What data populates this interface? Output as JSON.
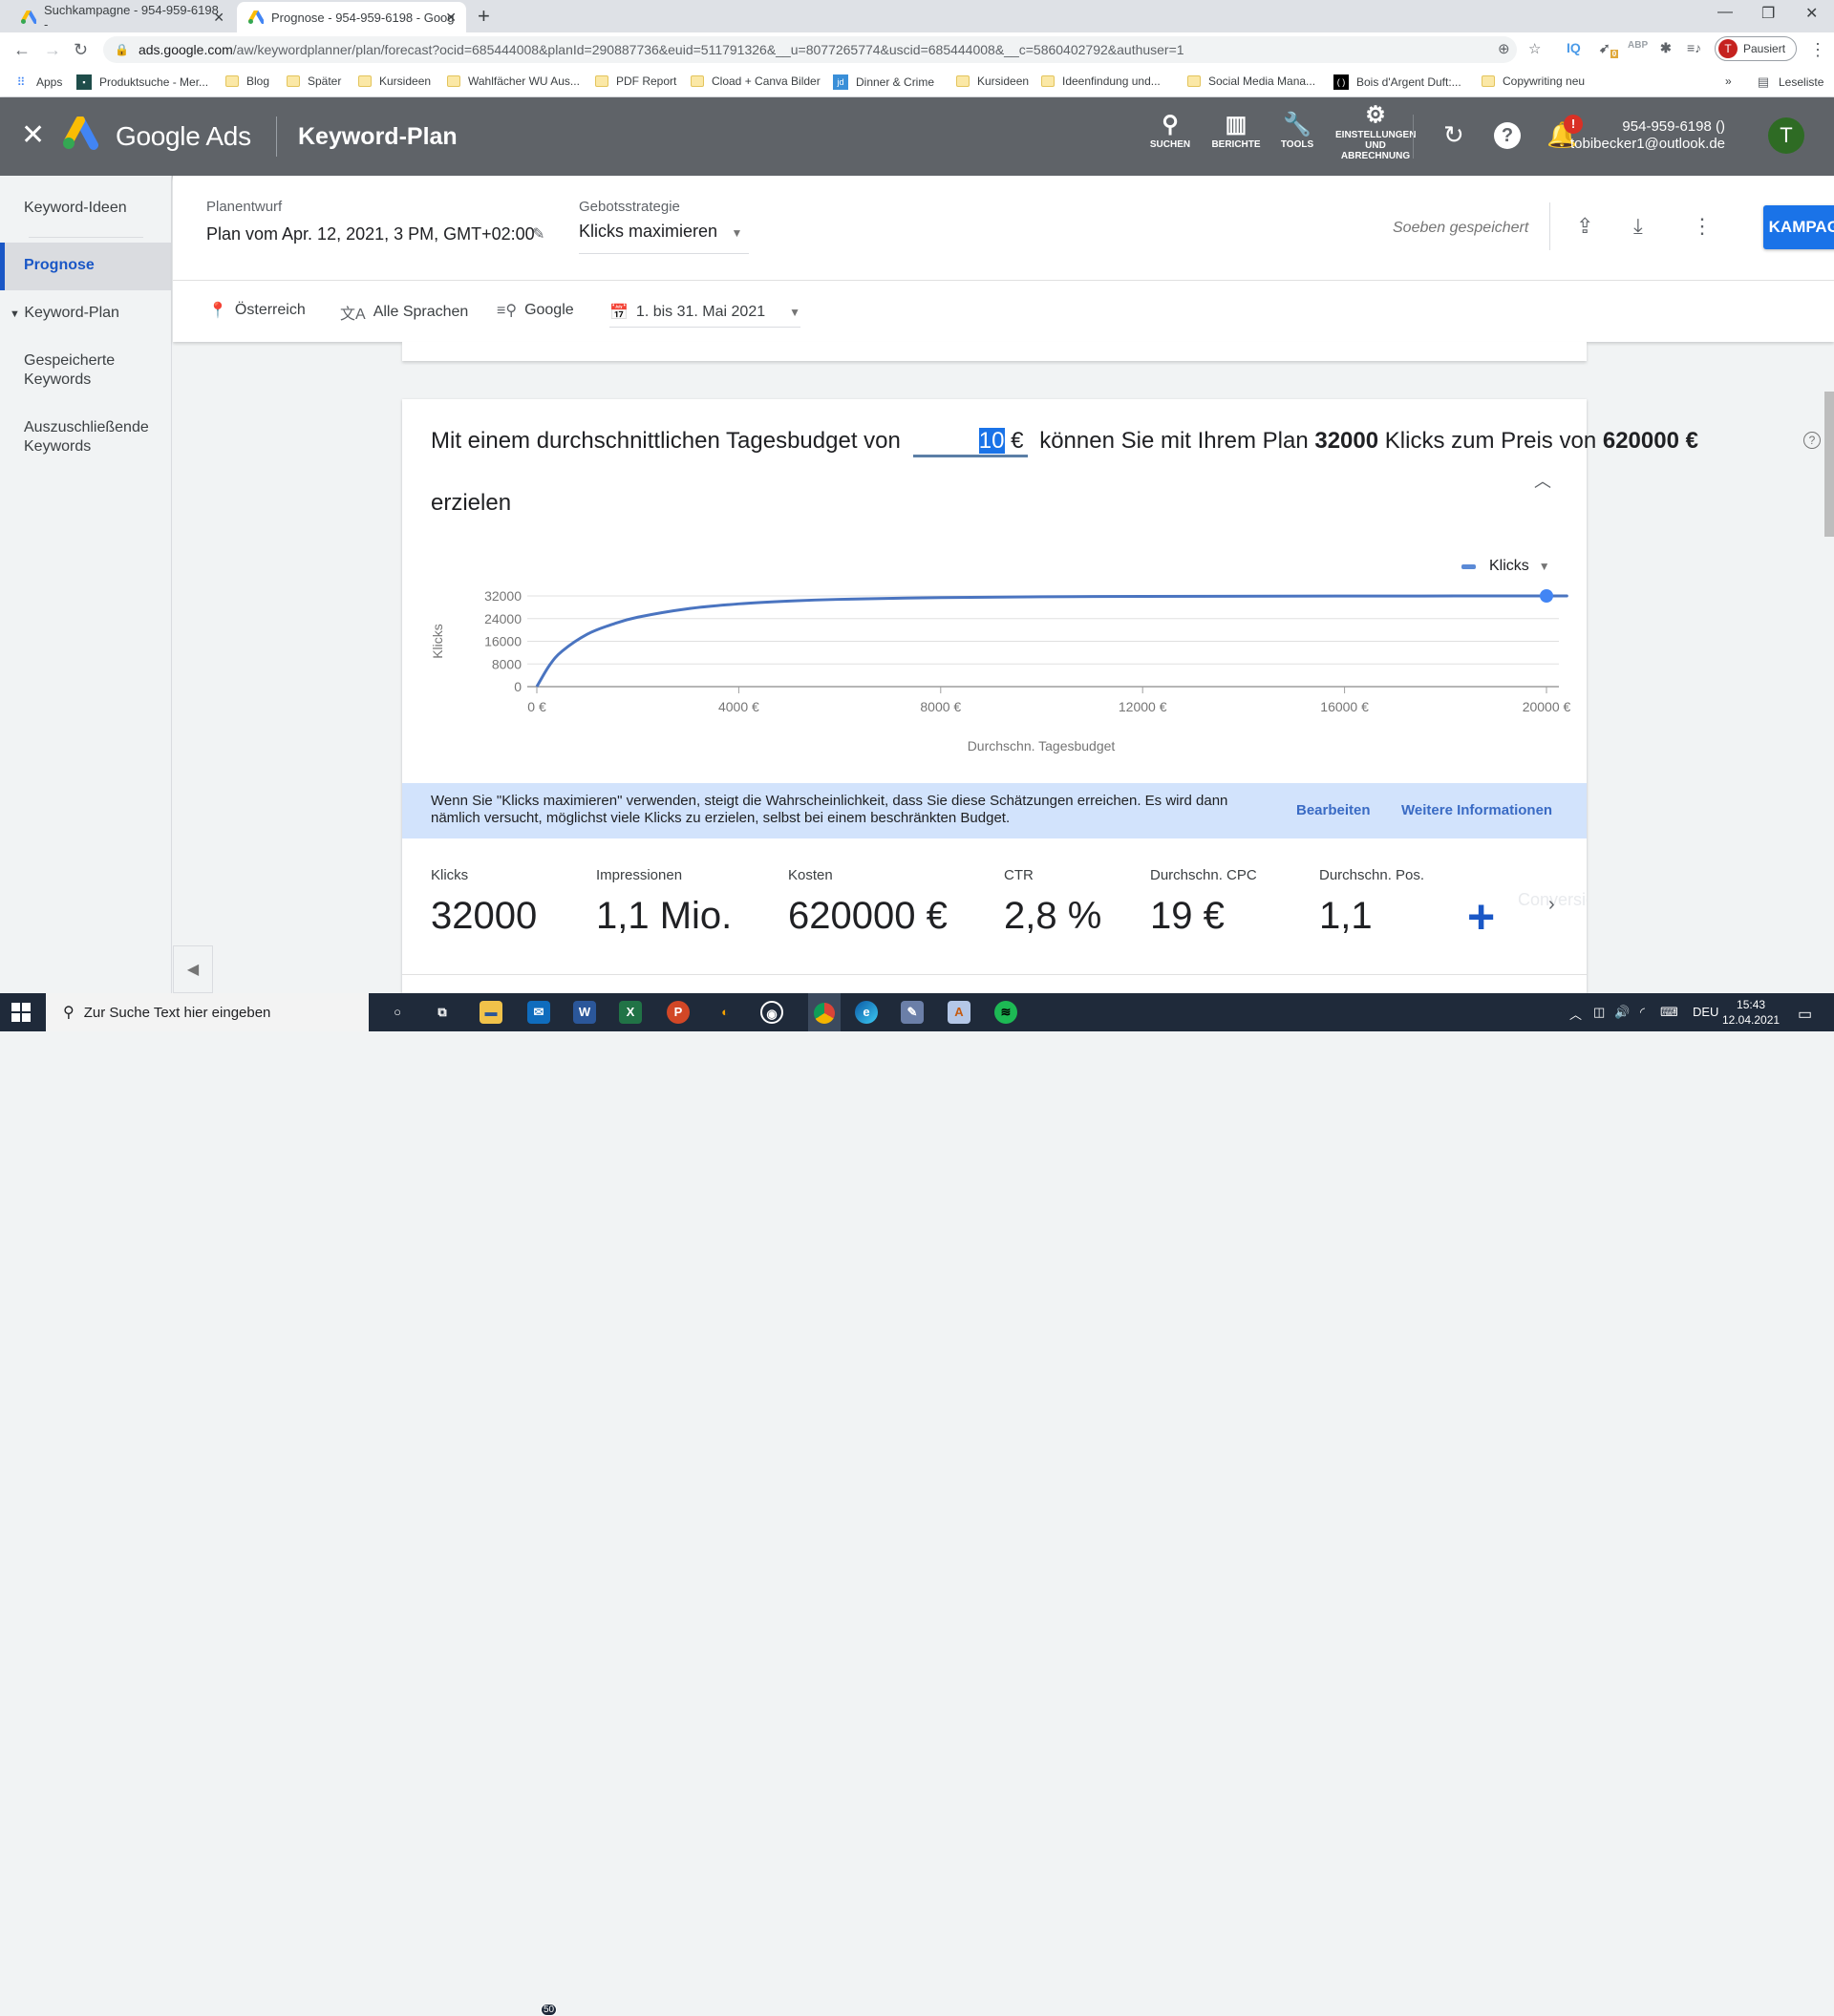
{
  "browser": {
    "tabs": [
      {
        "title": "Suchkampagne - 954-959-6198 -",
        "active": false
      },
      {
        "title": "Prognose - 954-959-6198 - Goog",
        "active": true
      }
    ],
    "url_host": "ads.google.com",
    "url_path": "/aw/keywordplanner/plan/forecast?ocid=685444008&planId=290887736&euid=511791326&__u=8077265774&uscid=685444008&__c=5860402792&authuser=1",
    "profile_label": "Pausiert",
    "profile_initial": "T",
    "extension_badge": "0",
    "bookmarks": [
      {
        "label": "Apps",
        "icon": "apps-grid-icon"
      },
      {
        "label": "Produktsuche - Mer...",
        "icon": "site-icon"
      },
      {
        "label": "Blog",
        "icon": "folder-icon"
      },
      {
        "label": "Später",
        "icon": "folder-icon"
      },
      {
        "label": "Kursideen",
        "icon": "folder-icon"
      },
      {
        "label": "Wahlfächer WU Aus...",
        "icon": "folder-icon"
      },
      {
        "label": "PDF Report",
        "icon": "folder-icon"
      },
      {
        "label": "Cload + Canva Bilder",
        "icon": "folder-icon"
      },
      {
        "label": "Dinner & Crime",
        "icon": "site-icon"
      },
      {
        "label": "Kursideen",
        "icon": "folder-icon"
      },
      {
        "label": "Ideenfindung und...",
        "icon": "folder-icon"
      },
      {
        "label": "Social Media Mana...",
        "icon": "folder-icon"
      },
      {
        "label": "Bois d'Argent Duft:...",
        "icon": "site-icon"
      },
      {
        "label": "Copywriting neu",
        "icon": "folder-icon"
      }
    ],
    "more_bookmarks": "»",
    "reading_list": "Leseliste"
  },
  "header": {
    "product": "Google Ads",
    "page_title": "Keyword-Plan",
    "tools": [
      {
        "label": "SUCHEN",
        "icon": "search-icon"
      },
      {
        "label": "BERICHTE",
        "icon": "reports-icon"
      },
      {
        "label": "TOOLS",
        "icon": "wrench-icon"
      },
      {
        "label": "EINSTELLUNGEN UND ABRECHNUNG",
        "icon": "gear-icon"
      }
    ],
    "notification_badge": "!",
    "account_id": "954-959-6198 ()",
    "account_email": "tobibecker1@outlook.de",
    "avatar_initial": "T"
  },
  "sidebar": {
    "items": [
      {
        "label": "Keyword-Ideen",
        "active": false
      },
      {
        "label": "Prognose",
        "active": true
      },
      {
        "label": "Keyword-Plan",
        "active": false,
        "expandable": true
      },
      {
        "label": "Gespeicherte Keywords",
        "active": false
      },
      {
        "label": "Auszuschließende Keywords",
        "active": false
      }
    ]
  },
  "plan": {
    "draft_label": "Planentwurf",
    "draft_name": "Plan vom Apr. 12, 2021, 3 PM, GMT+02:00",
    "bid_label": "Gebotsstrategie",
    "bid_value": "Klicks maximieren",
    "save_status": "Soeben gespeichert",
    "create_campaign": "KAMPAGNE ERSTELLEN",
    "filters": {
      "location": "Österreich",
      "language": "Alle Sprachen",
      "network": "Google",
      "date_range": "1. bis 31. Mai 2021"
    }
  },
  "forecast": {
    "sentence_prefix": "Mit einem durchschnittlichen Tagesbudget von",
    "budget_value": "10",
    "currency": "€",
    "sentence_mid": "können Sie mit Ihrem Plan",
    "clicks": "32000",
    "sentence_mid2": "Klicks zum Preis von",
    "cost": "620000 €",
    "sentence_suffix": "erzielen",
    "legend_metric": "Klicks",
    "info_text": "Wenn Sie \"Klicks maximieren\" verwenden, steigt die Wahrscheinlichkeit, dass Sie diese Schätzungen erreichen. Es wird dann nämlich versucht, möglichst viele Klicks zu erzielen, selbst bei einem beschränkten Budget.",
    "info_edit": "Bearbeiten",
    "info_more": "Weitere Informationen",
    "metrics": [
      {
        "label": "Klicks",
        "value": "32000"
      },
      {
        "label": "Impressionen",
        "value": "1,1 Mio."
      },
      {
        "label": "Kosten",
        "value": "620000 €"
      },
      {
        "label": "CTR",
        "value": "2,8 %"
      },
      {
        "label": "Durchschn. CPC",
        "value": "19 €"
      },
      {
        "label": "Durchschn. Pos.",
        "value": "1,1"
      }
    ],
    "add_metric_label": "Conversion-Messwerte hinzufügen"
  },
  "chart_data": {
    "type": "line",
    "title": "",
    "xlabel": "Durchschn. Tagesbudget",
    "ylabel": "Klicks",
    "xlim": [
      0,
      20000
    ],
    "ylim": [
      0,
      32000
    ],
    "x_ticks": [
      "0 €",
      "4000 €",
      "8000 €",
      "12000 €",
      "16000 €",
      "20000 €"
    ],
    "x_tick_values": [
      0,
      4000,
      8000,
      12000,
      16000,
      20000
    ],
    "y_ticks": [
      "0",
      "8000",
      "16000",
      "24000",
      "32000"
    ],
    "y_tick_values": [
      0,
      8000,
      16000,
      24000,
      32000
    ],
    "grid": true,
    "legend": "top-right",
    "series": [
      {
        "name": "Klicks",
        "color": "#4a74c0",
        "x": [
          0,
          250,
          500,
          1000,
          1500,
          2000,
          3000,
          4000,
          5000,
          6000,
          8000,
          10000,
          12000,
          16000,
          20000,
          20300
        ],
        "y": [
          0,
          7500,
          12500,
          18500,
          22000,
          24500,
          27500,
          29200,
          30200,
          30800,
          31400,
          31700,
          31850,
          31950,
          32000,
          32000
        ]
      }
    ],
    "selected_point": {
      "x": 20000,
      "y": 32000
    }
  },
  "taskbar": {
    "search_placeholder": "Zur Suche Text hier eingeben",
    "mail_badge": "50",
    "language": "DEU",
    "time": "15:43",
    "date": "12.04.2021"
  }
}
